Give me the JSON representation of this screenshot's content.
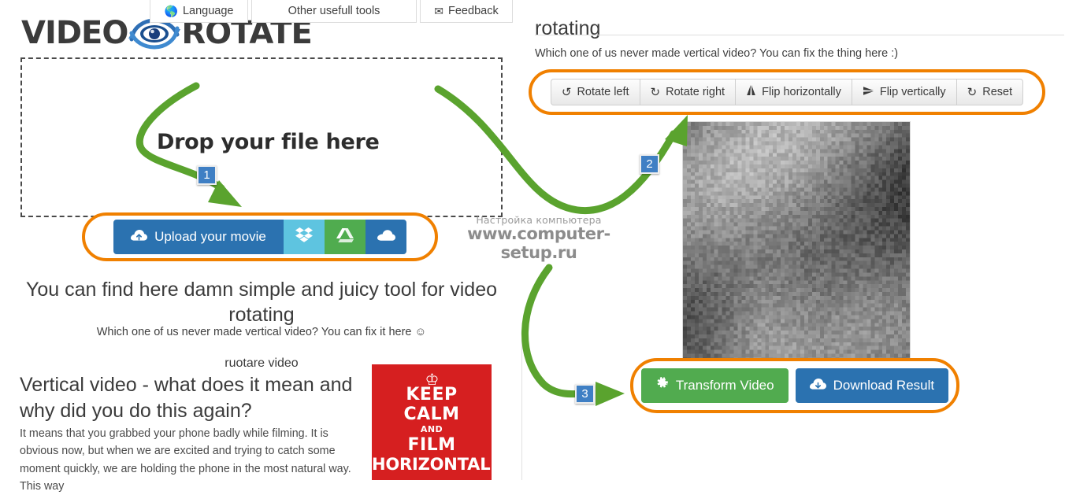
{
  "header": {
    "logo_text_left": "VIDEO",
    "logo_text_right": "ROTATE",
    "logo_icon": "eye-rotate-icon",
    "nav": [
      {
        "label": "Language",
        "icon": "globe-icon"
      },
      {
        "label": "Other usefull tools",
        "icon": ""
      },
      {
        "label": "Feedback",
        "icon": "envelope-icon"
      }
    ]
  },
  "left": {
    "dropzone_label": "Drop your file here",
    "upload_button": "Upload your movie",
    "upload_icon": "cloud-upload-icon",
    "cloud_buttons": [
      {
        "name": "dropbox",
        "icon": "dropbox-icon",
        "color": "#5ec4e0"
      },
      {
        "name": "google-drive",
        "icon": "google-drive-icon",
        "color": "#50ac4f"
      },
      {
        "name": "onedrive",
        "icon": "onedrive-icon",
        "color": "#2b72b0"
      }
    ],
    "tagline": "You can find here damn simple and juicy tool for video rotating",
    "subline": "Which one of us never made vertical video? You can fix it here ☺",
    "small_caption": "ruotare video",
    "article_heading": "Vertical video - what does it mean and why did you do this again?",
    "article_paragraph": "It means that you grabbed your phone badly while filming. It is obvious now, but when we are excited and trying to catch some moment quickly, we are holding the phone in the most natural way. This way",
    "poster": {
      "crown": "crown-icon",
      "line1": "KEEP",
      "line2": "CALM",
      "line3": "AND",
      "line4": "FILM",
      "line5": "HORIZONTALLY",
      "background": "#d61f20"
    }
  },
  "right": {
    "heading": "rotating",
    "subheading": "Which one of us never made vertical video? You can fix the thing here :)",
    "toolbar": [
      {
        "label": "Rotate left",
        "icon": "rotate-left-icon"
      },
      {
        "label": "Rotate right",
        "icon": "rotate-right-icon"
      },
      {
        "label": "Flip horizontally",
        "icon": "flip-horizontal-icon"
      },
      {
        "label": "Flip vertically",
        "icon": "flip-vertical-icon"
      },
      {
        "label": "Reset",
        "icon": "refresh-icon"
      }
    ],
    "preview_alt": "pixelated-video-preview",
    "actions": [
      {
        "label": "Transform Video",
        "icon": "gear-icon",
        "color": "#51ab4f"
      },
      {
        "label": "Download Result",
        "icon": "cloud-download-icon",
        "color": "#2b72b0"
      }
    ]
  },
  "annotations": {
    "highlight_color": "#f08000",
    "arrow_color": "#5aa32e",
    "badge_color": "#3f7fc4",
    "steps": [
      "1",
      "2",
      "3"
    ]
  },
  "watermark": {
    "line1": "Настройка компьютера",
    "line2": "www.computer-setup.ru"
  }
}
